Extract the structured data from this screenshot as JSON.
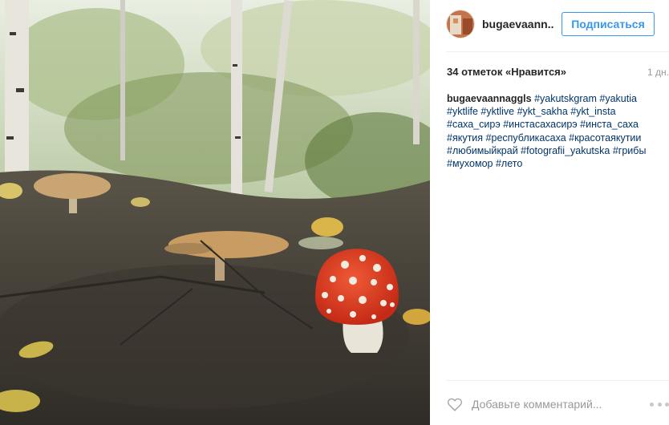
{
  "post": {
    "username": "bugaevaann...",
    "follow_label": "Подписаться",
    "likes": "34 отметок «Нравится»",
    "time": "1 дн.",
    "caption_user": "bugaevaannaggls",
    "hashtags": [
      "#yakutskgram",
      "#yakutia",
      "#yktlife",
      "#yktlive",
      "#ykt_sakha",
      "#ykt_insta",
      "#саха_сирэ",
      "#инстасахасирэ",
      "#инста_саха",
      "#якутия",
      "#республикасаха",
      "#красотаякутии",
      "#любимыйкрай",
      "#fotografii_yakutska",
      "#грибы",
      "#мухомор",
      "#лето"
    ],
    "comment_placeholder": "Добавьте комментарий..."
  },
  "photo": {
    "subject": "fly agaric mushroom on forest floor with birch trees"
  },
  "icons": {
    "heart": "heart-icon",
    "more": "more-options-icon"
  },
  "colors": {
    "follow": "#3897f0",
    "hashtag": "#003569",
    "separator": "#efefef"
  }
}
